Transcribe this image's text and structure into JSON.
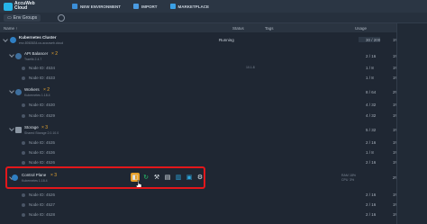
{
  "logo": {
    "line1": "AccuWeb",
    "line2": "Cloud"
  },
  "topnav": [
    {
      "label": "NEW ENVIRONMENT"
    },
    {
      "label": "IMPORT"
    },
    {
      "label": "MARKETPLACE"
    }
  ],
  "envbar": {
    "groups_label": "Env Groups"
  },
  "header": {
    "name": "Name ↑",
    "status": "Status",
    "tags": "Tags",
    "usage": "Usage"
  },
  "env": {
    "name": "Kubernetes Cluster",
    "domain": "env-8063634.us.accuweb.cloud",
    "status": "Running",
    "count": "30 / 200",
    "pct": "1%"
  },
  "groups": [
    {
      "name": "API Balancer",
      "mult": "× 2",
      "sub": "Traefik 2.4.7",
      "count": "2 / 16",
      "pct": "1%"
    },
    {
      "name": "Workers",
      "mult": "× 2",
      "sub": "Kubernetes 1.18.4",
      "count": "8 / 64",
      "pct": "2%"
    },
    {
      "name": "Storage",
      "mult": "× 3",
      "sub": "Shared Storage 2.0.10.0",
      "count": "5 / 32",
      "pct": "1%"
    },
    {
      "name": "Control Plane",
      "mult": "× 3",
      "sub": "Kubernetes 1.18.4",
      "count": "",
      "pct": "2%"
    }
  ],
  "nodes": [
    {
      "label": "Node ID: 4534",
      "count": "1 / 8",
      "pct": "1%"
    },
    {
      "label": "Node ID: 4533",
      "count": "1 / 8",
      "pct": "1%"
    },
    {
      "label": "Node ID: 4530",
      "count": "4 / 32",
      "pct": "1%"
    },
    {
      "label": "Node ID: 4529",
      "count": "4 / 32",
      "pct": "1%"
    },
    {
      "label": "Node ID: 4535",
      "count": "2 / 16",
      "pct": "1%"
    },
    {
      "label": "Node ID: 4536",
      "count": "1 / 8",
      "pct": "1%"
    },
    {
      "label": "Node ID: 4526",
      "count": "2 / 16",
      "pct": "1%"
    },
    {
      "label": "Node ID: 4527",
      "count": "2 / 16",
      "pct": "1%"
    },
    {
      "label": "Node ID: 4528",
      "count": "2 / 16",
      "pct": "1%"
    }
  ],
  "control_plane": {
    "ram": "RAM",
    "ram_pct": "18%",
    "cpu": "CPU",
    "cpu_pct": "3%"
  },
  "colors": {
    "accent": "#26b5e8",
    "highlight": "#e3171b",
    "active_tool": "#e69f2a"
  }
}
